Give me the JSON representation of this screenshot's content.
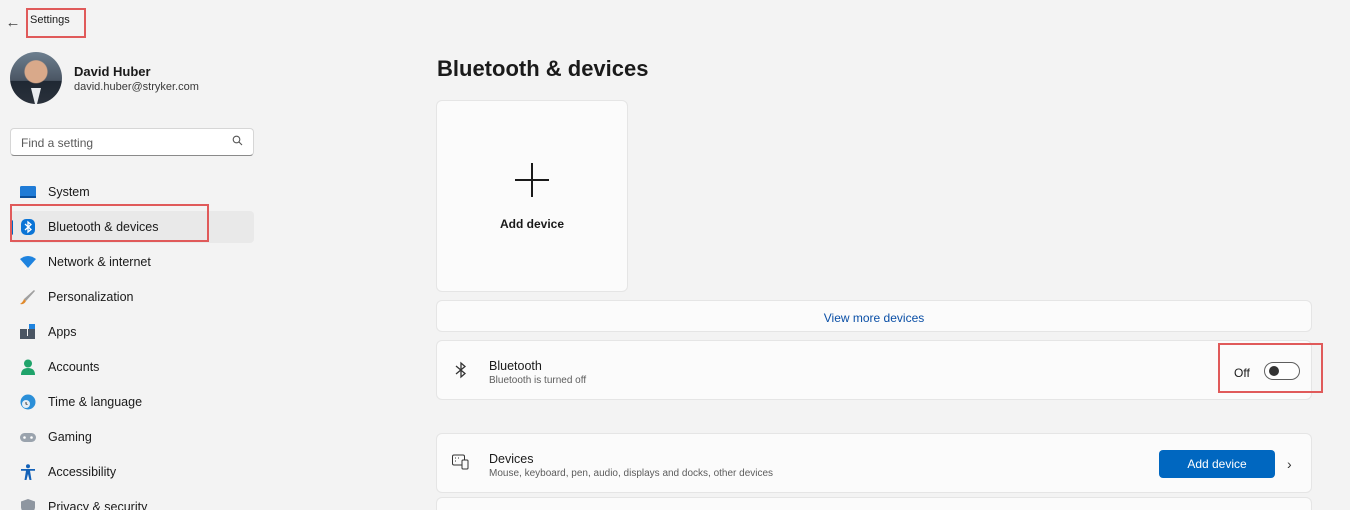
{
  "window": {
    "title": "Settings",
    "back_icon": "arrow-left-icon"
  },
  "profile": {
    "name": "David Huber",
    "email": "david.huber@stryker.com"
  },
  "search": {
    "placeholder": "Find a setting",
    "icon": "search-icon"
  },
  "sidebar": {
    "items": [
      {
        "label": "System",
        "icon": "system-icon",
        "active": false
      },
      {
        "label": "Bluetooth & devices",
        "icon": "bluetooth-icon",
        "active": true
      },
      {
        "label": "Network & internet",
        "icon": "wifi-icon",
        "active": false
      },
      {
        "label": "Personalization",
        "icon": "brush-icon",
        "active": false
      },
      {
        "label": "Apps",
        "icon": "apps-icon",
        "active": false
      },
      {
        "label": "Accounts",
        "icon": "person-icon",
        "active": false
      },
      {
        "label": "Time & language",
        "icon": "globe-clock-icon",
        "active": false
      },
      {
        "label": "Gaming",
        "icon": "gamepad-icon",
        "active": false
      },
      {
        "label": "Accessibility",
        "icon": "accessibility-icon",
        "active": false
      },
      {
        "label": "Privacy & security",
        "icon": "shield-icon",
        "active": false
      }
    ]
  },
  "main": {
    "title": "Bluetooth & devices",
    "add_device_tile": {
      "label": "Add device"
    },
    "view_more": {
      "label": "View more devices"
    },
    "bluetooth": {
      "title": "Bluetooth",
      "subtitle": "Bluetooth is turned off",
      "toggle_state": "Off",
      "enabled": false
    },
    "devices": {
      "title": "Devices",
      "subtitle": "Mouse, keyboard, pen, audio, displays and docks, other devices",
      "button_label": "Add device"
    }
  },
  "colors": {
    "accent": "#0067c0",
    "highlight_box": "#e05a5a",
    "background": "#f3f3f3"
  }
}
